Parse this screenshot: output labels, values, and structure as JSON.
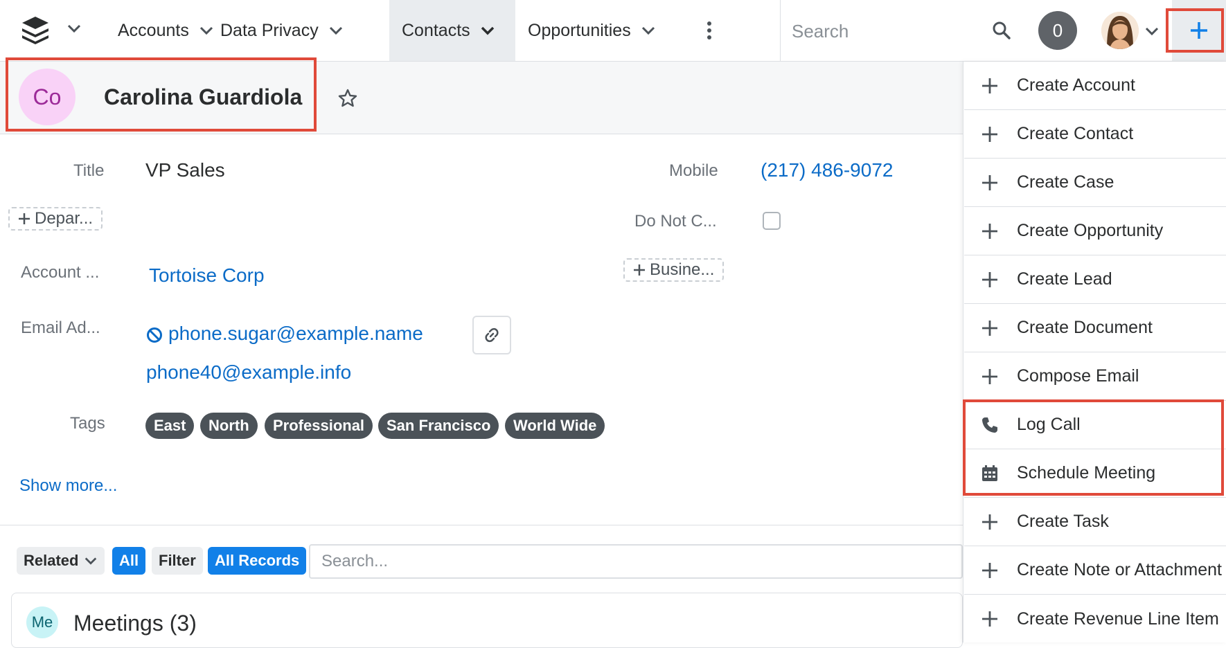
{
  "nav": {
    "tabs": [
      {
        "label": "Accounts"
      },
      {
        "label": "Data Privacy"
      },
      {
        "label": "Contacts"
      },
      {
        "label": "Opportunities"
      }
    ],
    "search_placeholder": "Search",
    "notification_count": "0"
  },
  "record": {
    "avatar_initials": "Co",
    "name": "Carolina Guardiola"
  },
  "fields": {
    "title_label": "Title",
    "title_value": "VP Sales",
    "mobile_label": "Mobile",
    "mobile_value": "(217) 486-9072",
    "department_button": "Depar...",
    "do_not_call_label": "Do Not C...",
    "account_label": "Account ...",
    "account_value": "Tortoise Corp",
    "business_button": "Busine...",
    "email_label": "Email Ad...",
    "email_primary": "phone.sugar@example.name",
    "email_secondary": "phone40@example.info",
    "tags_label": "Tags",
    "tags": [
      "East",
      "North",
      "Professional",
      "San Francisco",
      "World Wide"
    ],
    "show_more": "Show more..."
  },
  "related": {
    "related_label": "Related",
    "all_label": "All",
    "filter_label": "Filter",
    "all_records_label": "All Records",
    "search_placeholder": "Search...",
    "meetings_initials": "Me",
    "meetings_title": "Meetings (3)"
  },
  "quick_create": {
    "items": [
      {
        "label": "Create Account",
        "icon": "plus-icon"
      },
      {
        "label": "Create Contact",
        "icon": "plus-icon"
      },
      {
        "label": "Create Case",
        "icon": "plus-icon"
      },
      {
        "label": "Create Opportunity",
        "icon": "plus-icon"
      },
      {
        "label": "Create Lead",
        "icon": "plus-icon"
      },
      {
        "label": "Create Document",
        "icon": "plus-icon"
      },
      {
        "label": "Compose Email",
        "icon": "plus-icon"
      },
      {
        "label": "Log Call",
        "icon": "phone-icon"
      },
      {
        "label": "Schedule Meeting",
        "icon": "calendar-icon"
      },
      {
        "label": "Create Task",
        "icon": "plus-icon"
      },
      {
        "label": "Create Note or Attachment",
        "icon": "plus-icon"
      },
      {
        "label": "Create Revenue Line Item",
        "icon": "plus-icon"
      }
    ]
  },
  "colors": {
    "accent": "#1180e8",
    "link": "#0b6bc7",
    "highlight_box": "#e04a3a",
    "avatar_contact": "#f9d2f7",
    "tag_bg": "#4b5258"
  }
}
